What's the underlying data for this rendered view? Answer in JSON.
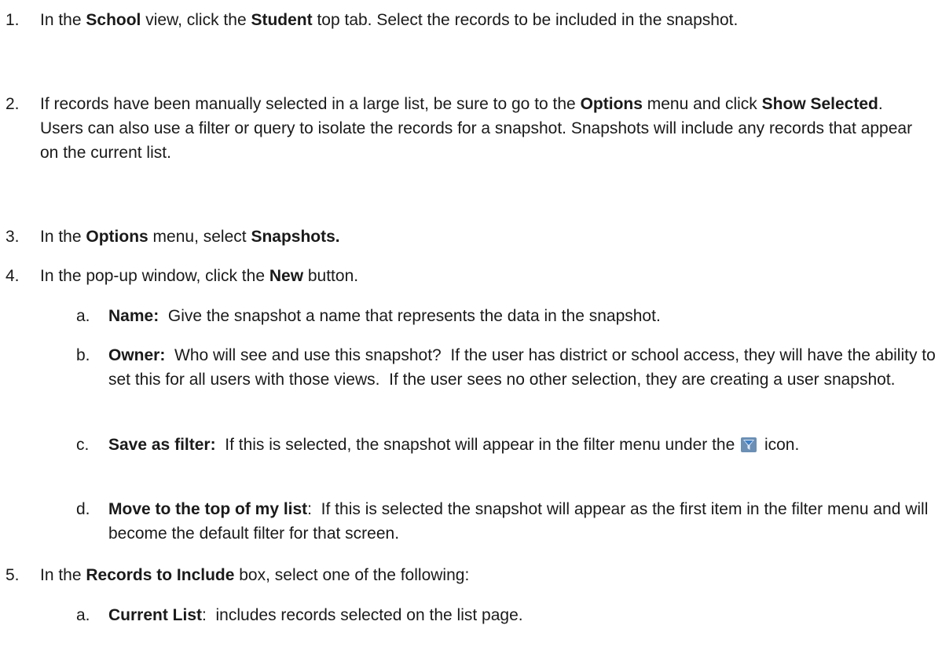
{
  "steps": [
    {
      "num": "1.",
      "p1": "In the ",
      "b1": "School",
      "p2": " view, click the ",
      "b2": "Student",
      "p3": " top tab.  Select the records to be included in the snapshot."
    },
    {
      "num": "2.",
      "p1": "If records have been manually selected in a large list, be sure to go to the ",
      "b1": "Options",
      "p2": " menu and click ",
      "b2": "Show Selected",
      "p3": ".  Users can also use a filter or query to isolate the records for a snapshot. Snapshots will include any records that appear on the current list."
    },
    {
      "num": "3.",
      "p1": "In the ",
      "b1": "Options",
      "p2": " menu, select ",
      "b2": "Snapshots."
    },
    {
      "num": "4.",
      "p1": "In the pop-up window, click the ",
      "b1": "New",
      "p2": " button."
    },
    {
      "num": "5.",
      "p1": "In the ",
      "b1": "Records to Include",
      "p2": " box, select one of the following:"
    }
  ],
  "substeps4": [
    {
      "letter": "a.",
      "b": "Name:",
      "t": "  Give the snapshot a name that represents the data in the snapshot."
    },
    {
      "letter": "b.",
      "b": "Owner:",
      "t": "  Who will see and use this snapshot?  If the user has district or school access, they will have the ability to set this for all users with those views.  If the user sees no other selection, they are creating a user snapshot."
    },
    {
      "letter": "c.",
      "b": "Save as filter:",
      "t": "  If this is selected, the snapshot will appear in the filter menu under the ",
      "t2": " icon."
    },
    {
      "letter": "d.",
      "b": "Move to the top of my list",
      "t": ":  If this is selected the snapshot will appear as the first item in the filter menu and will become the default filter for that screen."
    }
  ],
  "substeps5": [
    {
      "letter": "a.",
      "b": "Current List",
      "t": ":  includes records selected on the list page."
    }
  ],
  "filter_icon": "filter-funnel-icon",
  "colors": {
    "text": "#1a1a1a",
    "icon_funnel": "#3f7fc4",
    "icon_bg": "#6b8fb5"
  }
}
